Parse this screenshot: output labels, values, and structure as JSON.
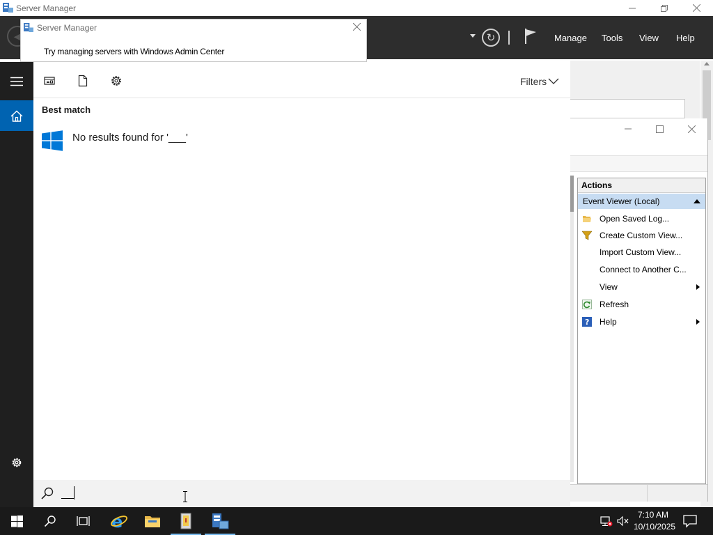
{
  "server_manager": {
    "window_title": "Server Manager",
    "menu": {
      "manage": "Manage",
      "tools": "Tools",
      "view": "View",
      "help": "Help"
    }
  },
  "popup": {
    "title": "Server Manager",
    "message": "Try managing servers with Windows Admin Center"
  },
  "event_viewer": {
    "actions_header": "Actions",
    "section": "Event Viewer (Local)",
    "items": [
      {
        "label": "Open Saved Log...",
        "icon": "folder-open-icon",
        "submenu": false
      },
      {
        "label": "Create Custom View...",
        "icon": "filter-icon",
        "submenu": false
      },
      {
        "label": "Import Custom View...",
        "icon": "",
        "submenu": false
      },
      {
        "label": "Connect to Another C...",
        "icon": "",
        "submenu": false
      },
      {
        "label": "View",
        "icon": "",
        "submenu": true
      },
      {
        "label": "Refresh",
        "icon": "refresh-icon",
        "submenu": false
      },
      {
        "label": "Help",
        "icon": "help-icon",
        "submenu": true
      }
    ]
  },
  "search": {
    "filters_label": "Filters",
    "best_match_label": "Best match",
    "no_results_text": "No results found for '___'",
    "query_value": "__"
  },
  "taskbar": {
    "time": "7:10 AM",
    "date": "10/10/2025",
    "pinned": [
      "start-icon",
      "search-icon",
      "task-view-icon",
      "internet-explorer-icon",
      "file-explorer-icon",
      "event-viewer-icon",
      "server-manager-icon"
    ]
  },
  "colors": {
    "accent": "#0063b1",
    "sm_header": "#2d2d2d",
    "taskbar": "#1a1a1a",
    "selection": "#c7dcf2"
  }
}
